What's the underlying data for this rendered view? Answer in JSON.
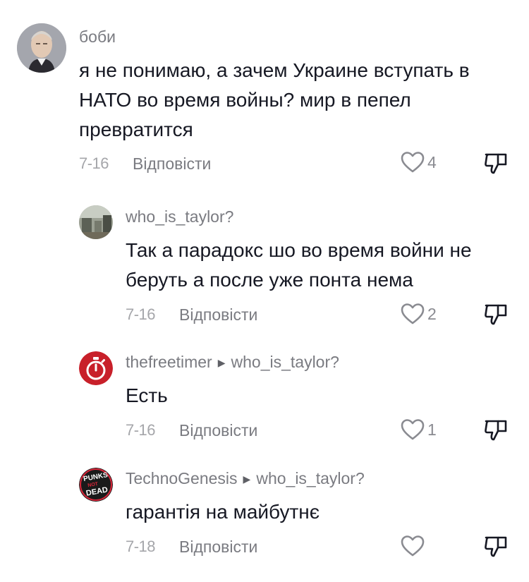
{
  "comments": [
    {
      "username": "боби",
      "text_lines": [
        "я не понимаю, а зачем Украине вступать в",
        "НАТО во время войны? мир в пепел",
        "превратится"
      ],
      "date": "7-16",
      "reply_label": "Відповісти",
      "likes": "4"
    },
    {
      "username": "who_is_taylor?",
      "text_lines": [
        "Так а парадокс шо во время войни не",
        "беруть а после уже понта нема"
      ],
      "date": "7-16",
      "reply_label": "Відповісти",
      "likes": "2"
    },
    {
      "username": "thefreetimer",
      "reply_to": "who_is_taylor?",
      "text_lines": [
        "Есть"
      ],
      "date": "7-16",
      "reply_label": "Відповісти",
      "likes": "1"
    },
    {
      "username": "TechnoGenesis",
      "reply_to": "who_is_taylor?",
      "text_lines": [
        "гарантія на майбутнє"
      ],
      "date": "7-18",
      "reply_label": "Відповісти",
      "likes": "",
      "avatar_text": [
        "PUNKS",
        "NOT",
        "DEAD"
      ]
    }
  ],
  "colors": {
    "text": "#161823",
    "muted": "#7a7b81",
    "date": "#a5a6aa",
    "timer_red": "#c8202a"
  }
}
